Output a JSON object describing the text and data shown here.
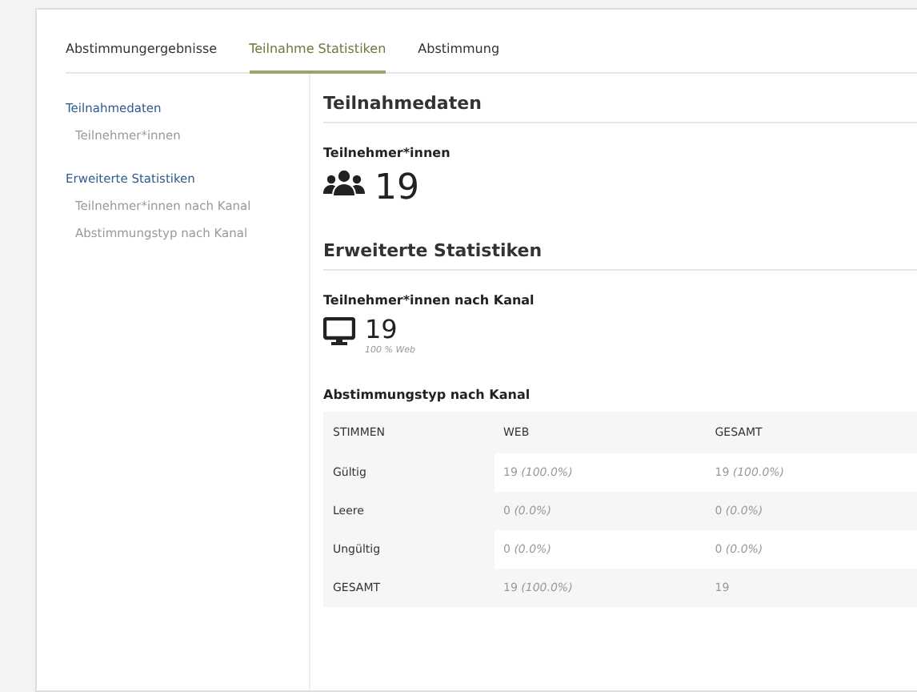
{
  "tabs": [
    {
      "label": "Abstimmungergebnisse",
      "selected": false
    },
    {
      "label": "Teilnahme Statistiken",
      "selected": true
    },
    {
      "label": "Abstimmung",
      "selected": false
    }
  ],
  "sidebar": {
    "items": [
      {
        "label": "Teilnahmedaten",
        "children": [
          {
            "label": "Teilnehmer*innen"
          }
        ]
      },
      {
        "label": "Erweiterte Statistiken",
        "children": [
          {
            "label": "Teilnehmer*innen nach Kanal"
          },
          {
            "label": "Abstimmungstyp nach Kanal"
          }
        ]
      }
    ]
  },
  "sections": [
    {
      "title": "Teilnahmedaten",
      "blocks": [
        {
          "kind": "stat",
          "title": "Teilnehmer*innen",
          "value": "19"
        }
      ]
    },
    {
      "title": "Erweiterte Statistiken",
      "blocks": [
        {
          "kind": "stat",
          "title": "Teilnehmer*innen nach Kanal",
          "value": "19",
          "caption": "100 % Web"
        },
        {
          "kind": "table",
          "title": "Abstimmungstyp nach Kanal",
          "columns": [
            "STIMMEN",
            "WEB",
            "GESAMT"
          ],
          "rows": [
            [
              "Gültig",
              "19 *(100.0%)*",
              "19 *(100.0%)*"
            ],
            [
              "Leere",
              "0 *(0.0%)*",
              "0 *(0.0%)*"
            ],
            [
              "Ungültig",
              "0 *(0.0%)*",
              "0 *(0.0%)*"
            ],
            [
              "GESAMT",
              "19 *(100.0%)*",
              "19"
            ]
          ]
        }
      ]
    }
  ]
}
